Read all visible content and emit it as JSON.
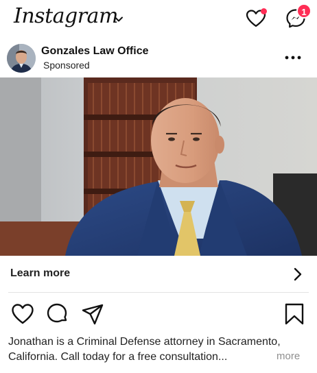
{
  "app": {
    "title": "Instagram",
    "notification_badge": "1"
  },
  "post": {
    "account_name": "Gonzales Law Office",
    "sponsored_label": "Sponsored",
    "cta_label": "Learn more",
    "caption": "Jonathan is a Criminal Defense attorney in Sacramento, California. Call today for a free consultation...",
    "caption_more": "more"
  },
  "icons": {
    "logo_dropdown": "chevron-down-icon",
    "activity": "heart-icon",
    "messages": "messenger-icon",
    "post_menu": "more-horizontal-icon",
    "cta": "chevron-right-icon",
    "like": "heart-icon",
    "comment": "comment-icon",
    "share": "paper-plane-icon",
    "save": "bookmark-icon"
  },
  "colors": {
    "badge": "#ff2d55",
    "text": "#111111",
    "muted": "#8e8e8e"
  }
}
